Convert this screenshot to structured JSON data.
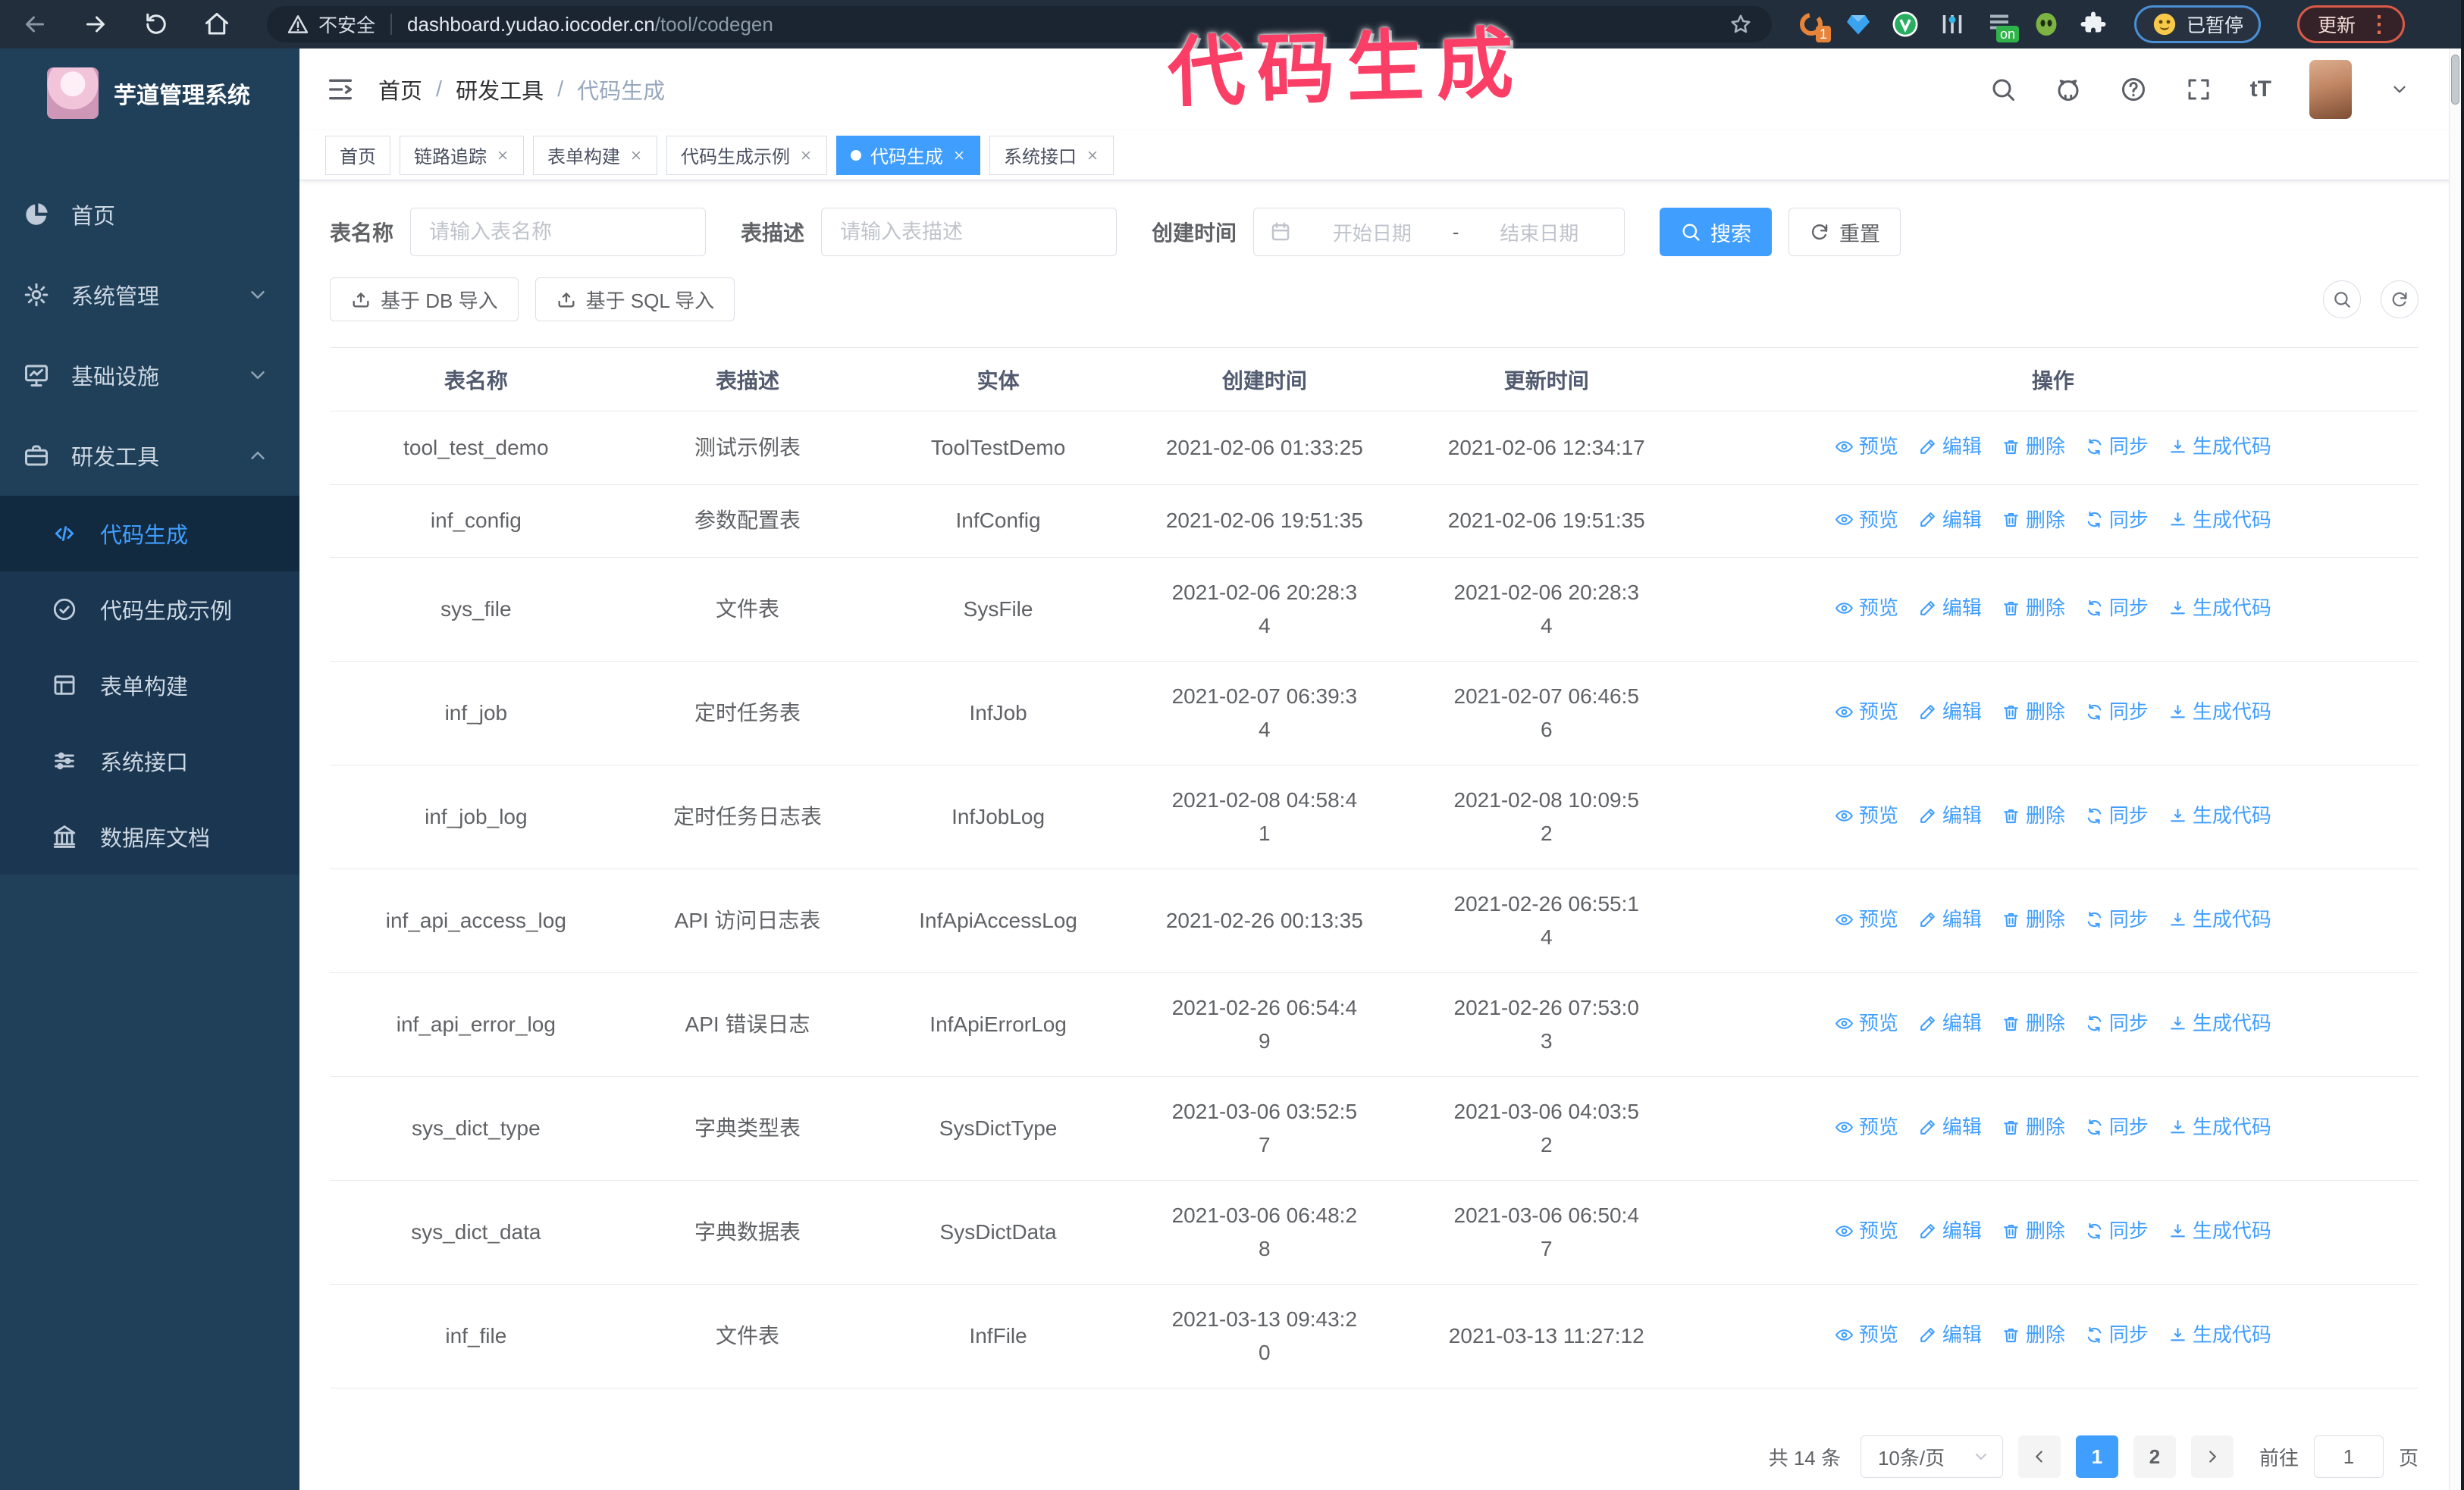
{
  "browser": {
    "security_label": "不安全",
    "url_host": "dashboard.yudao.iocoder.cn",
    "url_path": "/tool/codegen",
    "extension_badge": "1",
    "extension_on_badge": "on",
    "paused_badge": "已暂停",
    "update_button": "更新"
  },
  "annotation": {
    "text": "代码生成"
  },
  "colors": {
    "accent": "#409eff",
    "sidebar_bg": "#20405a",
    "annotation_pink": "#fb3e66",
    "chrome_bg": "#222e3c"
  },
  "sidebar": {
    "title": "芋道管理系统",
    "items": [
      {
        "label": "首页",
        "icon": "dashboard-icon",
        "expandable": false,
        "expanded": false
      },
      {
        "label": "系统管理",
        "icon": "gear-icon",
        "expandable": true,
        "expanded": false
      },
      {
        "label": "基础设施",
        "icon": "infrastructure-icon",
        "expandable": true,
        "expanded": false
      },
      {
        "label": "研发工具",
        "icon": "tools-icon",
        "expandable": true,
        "expanded": true
      }
    ],
    "submenu": [
      {
        "label": "代码生成",
        "icon": "code-icon",
        "active": true
      },
      {
        "label": "代码生成示例",
        "icon": "example-icon",
        "active": false
      },
      {
        "label": "表单构建",
        "icon": "form-icon",
        "active": false
      },
      {
        "label": "系统接口",
        "icon": "api-icon",
        "active": false
      },
      {
        "label": "数据库文档",
        "icon": "database-icon",
        "active": false
      }
    ]
  },
  "header": {
    "breadcrumb": [
      "首页",
      "研发工具",
      "代码生成"
    ]
  },
  "tabs": [
    {
      "label": "首页",
      "closable": false,
      "active": false
    },
    {
      "label": "链路追踪",
      "closable": true,
      "active": false
    },
    {
      "label": "表单构建",
      "closable": true,
      "active": false
    },
    {
      "label": "代码生成示例",
      "closable": true,
      "active": false
    },
    {
      "label": "代码生成",
      "closable": true,
      "active": true
    },
    {
      "label": "系统接口",
      "closable": true,
      "active": false
    }
  ],
  "filters": {
    "table_name_label": "表名称",
    "table_name_placeholder": "请输入表名称",
    "table_desc_label": "表描述",
    "table_desc_placeholder": "请输入表描述",
    "create_time_label": "创建时间",
    "date_start_placeholder": "开始日期",
    "date_separator": "-",
    "date_end_placeholder": "结束日期",
    "search_label": "搜索",
    "reset_label": "重置"
  },
  "toolbar": {
    "db_import_label": "基于 DB 导入",
    "sql_import_label": "基于 SQL 导入"
  },
  "table": {
    "columns": [
      "表名称",
      "表描述",
      "实体",
      "创建时间",
      "更新时间",
      "操作"
    ],
    "action_labels": [
      "预览",
      "编辑",
      "删除",
      "同步",
      "生成代码"
    ],
    "rows": [
      {
        "name": "tool_test_demo",
        "desc": "测试示例表",
        "entity": "ToolTestDemo",
        "created": "2021-02-06 01:33:25",
        "updated": "2021-02-06 12:34:17"
      },
      {
        "name": "inf_config",
        "desc": "参数配置表",
        "entity": "InfConfig",
        "created": "2021-02-06 19:51:35",
        "updated": "2021-02-06 19:51:35"
      },
      {
        "name": "sys_file",
        "desc": "文件表",
        "entity": "SysFile",
        "created": "2021-02-06 20:28:3\n4",
        "updated": "2021-02-06 20:28:3\n4"
      },
      {
        "name": "inf_job",
        "desc": "定时任务表",
        "entity": "InfJob",
        "created": "2021-02-07 06:39:3\n4",
        "updated": "2021-02-07 06:46:5\n6"
      },
      {
        "name": "inf_job_log",
        "desc": "定时任务日志表",
        "entity": "InfJobLog",
        "created": "2021-02-08 04:58:4\n1",
        "updated": "2021-02-08 10:09:5\n2"
      },
      {
        "name": "inf_api_access_log",
        "desc": "API 访问日志表",
        "entity": "InfApiAccessLog",
        "created": "2021-02-26 00:13:35",
        "updated": "2021-02-26 06:55:1\n4"
      },
      {
        "name": "inf_api_error_log",
        "desc": "API 错误日志",
        "entity": "InfApiErrorLog",
        "created": "2021-02-26 06:54:4\n9",
        "updated": "2021-02-26 07:53:0\n3"
      },
      {
        "name": "sys_dict_type",
        "desc": "字典类型表",
        "entity": "SysDictType",
        "created": "2021-03-06 03:52:5\n7",
        "updated": "2021-03-06 04:03:5\n2"
      },
      {
        "name": "sys_dict_data",
        "desc": "字典数据表",
        "entity": "SysDictData",
        "created": "2021-03-06 06:48:2\n8",
        "updated": "2021-03-06 06:50:4\n7"
      },
      {
        "name": "inf_file",
        "desc": "文件表",
        "entity": "InfFile",
        "created": "2021-03-13 09:43:2\n0",
        "updated": "2021-03-13 11:27:12"
      }
    ]
  },
  "pagination": {
    "total_label": "共 14 条",
    "page_size": "10条/页",
    "pages": [
      "1",
      "2"
    ],
    "active_page": "1",
    "goto_label": "前往",
    "goto_value": "1",
    "page_suffix_label": "页"
  }
}
